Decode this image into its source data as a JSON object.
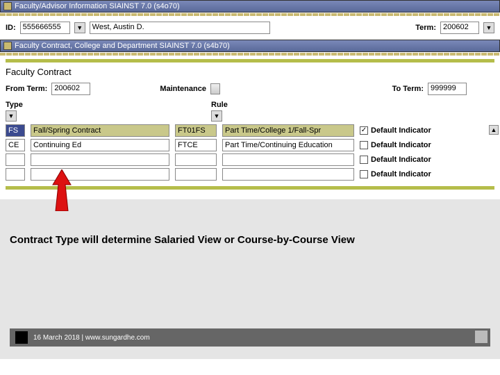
{
  "window1": {
    "title": "Faculty/Advisor Information  SIAINST  7.0  (s4o70)"
  },
  "idrow": {
    "id_label": "ID:",
    "id_value": "555666555",
    "name_value": "West, Austin D.",
    "term_label": "Term:",
    "term_value": "200602"
  },
  "window2": {
    "title": "Faculty Contract, College and Department  SIAINST  7.0  (s4b70)"
  },
  "section": {
    "title": "Faculty Contract",
    "from_label": "From Term:",
    "from_value": "200602",
    "maintenance_label": "Maintenance",
    "to_label": "To Term:",
    "to_value": "999999",
    "type_header": "Type",
    "rule_header": "Rule"
  },
  "rows": [
    {
      "type": "FS",
      "typedesc": "Fall/Spring Contract",
      "rule": "FT01FS",
      "ruledesc": "Part Time/College 1/Fall-Spr",
      "checked": true,
      "default_label": "Default Indicator"
    },
    {
      "type": "CE",
      "typedesc": "Continuing Ed",
      "rule": "FTCE",
      "ruledesc": "Part Time/Continuing Education",
      "checked": false,
      "default_label": "Default Indicator"
    },
    {
      "type": "",
      "typedesc": "",
      "rule": "",
      "ruledesc": "",
      "checked": false,
      "default_label": "Default Indicator"
    },
    {
      "type": "",
      "typedesc": "",
      "rule": "",
      "ruledesc": "",
      "checked": false,
      "default_label": "Default Indicator"
    }
  ],
  "annotation": {
    "text": "Contract Type will determine Salaried View or Course-by-Course View"
  },
  "footer": {
    "text": "16 March 2018 | www.sungardhe.com"
  }
}
